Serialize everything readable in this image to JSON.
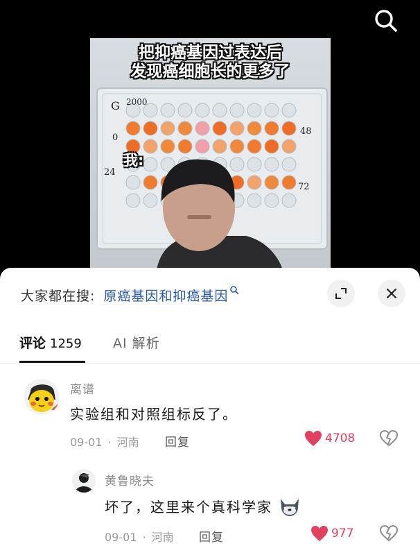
{
  "video": {
    "caption_line1": "把抑癌基因过表达后",
    "caption_line2": "发现癌细胞长的更多了",
    "overlay_me": "我:",
    "plate_labels": {
      "g": "G",
      "top": "2000",
      "left0": "0",
      "left24": "24",
      "right48": "48",
      "right72": "72"
    }
  },
  "search_bar": {
    "prefix": "大家都在搜:",
    "term": "原癌基因和抑癌基因"
  },
  "tabs": {
    "comments_label": "评论",
    "comments_count": "1259",
    "ai_label": "AI 解析"
  },
  "comments": [
    {
      "username": "离谱",
      "text": "实验组和对照组标反了。",
      "date": "09-01",
      "location": "河南",
      "reply_label": "回复",
      "likes": "4708"
    },
    {
      "username": "黄鲁晓夫",
      "text": "坏了，这里来个真科学家",
      "date": "09-01",
      "location": "河南",
      "reply_label": "回复",
      "likes": "977"
    }
  ],
  "colors": {
    "like": "#e1405f",
    "link": "#2a5aa8"
  },
  "icons": [
    "search-icon",
    "expand-icon",
    "close-icon",
    "heart-icon",
    "broken-heart-icon",
    "search-small-icon"
  ]
}
